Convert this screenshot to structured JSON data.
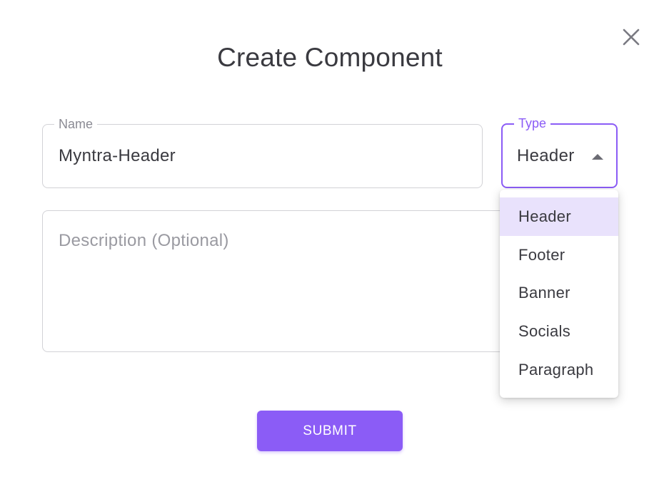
{
  "dialog": {
    "title": "Create Component",
    "close_icon": "close-icon"
  },
  "form": {
    "name": {
      "label": "Name",
      "value": "Myntra-Header"
    },
    "type": {
      "label": "Type",
      "value": "Header",
      "arrow_icon": "caret-up-icon",
      "options": [
        "Header",
        "Footer",
        "Banner",
        "Socials",
        "Paragraph"
      ],
      "selected_index": 0
    },
    "description": {
      "placeholder": "Description (Optional)",
      "value": ""
    },
    "submit_label": "SUBMIT"
  },
  "colors": {
    "accent": "#8b5cf6",
    "selected_option_bg": "#e9e2fc",
    "text": "#3a3a40"
  }
}
